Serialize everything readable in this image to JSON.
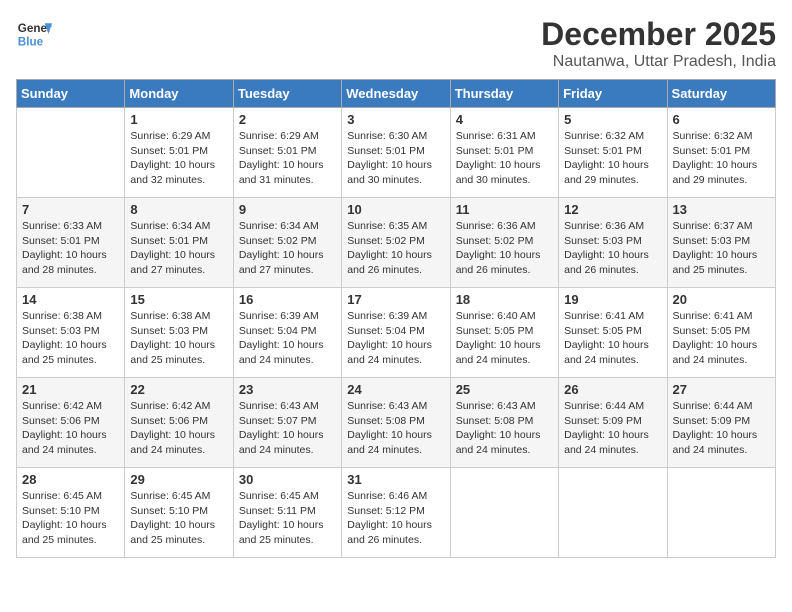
{
  "logo": {
    "line1": "General",
    "line2": "Blue"
  },
  "title": "December 2025",
  "subtitle": "Nautanwa, Uttar Pradesh, India",
  "headers": [
    "Sunday",
    "Monday",
    "Tuesday",
    "Wednesday",
    "Thursday",
    "Friday",
    "Saturday"
  ],
  "weeks": [
    [
      {
        "day": "",
        "sunrise": "",
        "sunset": "",
        "daylight": ""
      },
      {
        "day": "1",
        "sunrise": "Sunrise: 6:29 AM",
        "sunset": "Sunset: 5:01 PM",
        "daylight": "Daylight: 10 hours and 32 minutes."
      },
      {
        "day": "2",
        "sunrise": "Sunrise: 6:29 AM",
        "sunset": "Sunset: 5:01 PM",
        "daylight": "Daylight: 10 hours and 31 minutes."
      },
      {
        "day": "3",
        "sunrise": "Sunrise: 6:30 AM",
        "sunset": "Sunset: 5:01 PM",
        "daylight": "Daylight: 10 hours and 30 minutes."
      },
      {
        "day": "4",
        "sunrise": "Sunrise: 6:31 AM",
        "sunset": "Sunset: 5:01 PM",
        "daylight": "Daylight: 10 hours and 30 minutes."
      },
      {
        "day": "5",
        "sunrise": "Sunrise: 6:32 AM",
        "sunset": "Sunset: 5:01 PM",
        "daylight": "Daylight: 10 hours and 29 minutes."
      },
      {
        "day": "6",
        "sunrise": "Sunrise: 6:32 AM",
        "sunset": "Sunset: 5:01 PM",
        "daylight": "Daylight: 10 hours and 29 minutes."
      }
    ],
    [
      {
        "day": "7",
        "sunrise": "Sunrise: 6:33 AM",
        "sunset": "Sunset: 5:01 PM",
        "daylight": "Daylight: 10 hours and 28 minutes."
      },
      {
        "day": "8",
        "sunrise": "Sunrise: 6:34 AM",
        "sunset": "Sunset: 5:01 PM",
        "daylight": "Daylight: 10 hours and 27 minutes."
      },
      {
        "day": "9",
        "sunrise": "Sunrise: 6:34 AM",
        "sunset": "Sunset: 5:02 PM",
        "daylight": "Daylight: 10 hours and 27 minutes."
      },
      {
        "day": "10",
        "sunrise": "Sunrise: 6:35 AM",
        "sunset": "Sunset: 5:02 PM",
        "daylight": "Daylight: 10 hours and 26 minutes."
      },
      {
        "day": "11",
        "sunrise": "Sunrise: 6:36 AM",
        "sunset": "Sunset: 5:02 PM",
        "daylight": "Daylight: 10 hours and 26 minutes."
      },
      {
        "day": "12",
        "sunrise": "Sunrise: 6:36 AM",
        "sunset": "Sunset: 5:03 PM",
        "daylight": "Daylight: 10 hours and 26 minutes."
      },
      {
        "day": "13",
        "sunrise": "Sunrise: 6:37 AM",
        "sunset": "Sunset: 5:03 PM",
        "daylight": "Daylight: 10 hours and 25 minutes."
      }
    ],
    [
      {
        "day": "14",
        "sunrise": "Sunrise: 6:38 AM",
        "sunset": "Sunset: 5:03 PM",
        "daylight": "Daylight: 10 hours and 25 minutes."
      },
      {
        "day": "15",
        "sunrise": "Sunrise: 6:38 AM",
        "sunset": "Sunset: 5:03 PM",
        "daylight": "Daylight: 10 hours and 25 minutes."
      },
      {
        "day": "16",
        "sunrise": "Sunrise: 6:39 AM",
        "sunset": "Sunset: 5:04 PM",
        "daylight": "Daylight: 10 hours and 24 minutes."
      },
      {
        "day": "17",
        "sunrise": "Sunrise: 6:39 AM",
        "sunset": "Sunset: 5:04 PM",
        "daylight": "Daylight: 10 hours and 24 minutes."
      },
      {
        "day": "18",
        "sunrise": "Sunrise: 6:40 AM",
        "sunset": "Sunset: 5:05 PM",
        "daylight": "Daylight: 10 hours and 24 minutes."
      },
      {
        "day": "19",
        "sunrise": "Sunrise: 6:41 AM",
        "sunset": "Sunset: 5:05 PM",
        "daylight": "Daylight: 10 hours and 24 minutes."
      },
      {
        "day": "20",
        "sunrise": "Sunrise: 6:41 AM",
        "sunset": "Sunset: 5:05 PM",
        "daylight": "Daylight: 10 hours and 24 minutes."
      }
    ],
    [
      {
        "day": "21",
        "sunrise": "Sunrise: 6:42 AM",
        "sunset": "Sunset: 5:06 PM",
        "daylight": "Daylight: 10 hours and 24 minutes."
      },
      {
        "day": "22",
        "sunrise": "Sunrise: 6:42 AM",
        "sunset": "Sunset: 5:06 PM",
        "daylight": "Daylight: 10 hours and 24 minutes."
      },
      {
        "day": "23",
        "sunrise": "Sunrise: 6:43 AM",
        "sunset": "Sunset: 5:07 PM",
        "daylight": "Daylight: 10 hours and 24 minutes."
      },
      {
        "day": "24",
        "sunrise": "Sunrise: 6:43 AM",
        "sunset": "Sunset: 5:08 PM",
        "daylight": "Daylight: 10 hours and 24 minutes."
      },
      {
        "day": "25",
        "sunrise": "Sunrise: 6:43 AM",
        "sunset": "Sunset: 5:08 PM",
        "daylight": "Daylight: 10 hours and 24 minutes."
      },
      {
        "day": "26",
        "sunrise": "Sunrise: 6:44 AM",
        "sunset": "Sunset: 5:09 PM",
        "daylight": "Daylight: 10 hours and 24 minutes."
      },
      {
        "day": "27",
        "sunrise": "Sunrise: 6:44 AM",
        "sunset": "Sunset: 5:09 PM",
        "daylight": "Daylight: 10 hours and 24 minutes."
      }
    ],
    [
      {
        "day": "28",
        "sunrise": "Sunrise: 6:45 AM",
        "sunset": "Sunset: 5:10 PM",
        "daylight": "Daylight: 10 hours and 25 minutes."
      },
      {
        "day": "29",
        "sunrise": "Sunrise: 6:45 AM",
        "sunset": "Sunset: 5:10 PM",
        "daylight": "Daylight: 10 hours and 25 minutes."
      },
      {
        "day": "30",
        "sunrise": "Sunrise: 6:45 AM",
        "sunset": "Sunset: 5:11 PM",
        "daylight": "Daylight: 10 hours and 25 minutes."
      },
      {
        "day": "31",
        "sunrise": "Sunrise: 6:46 AM",
        "sunset": "Sunset: 5:12 PM",
        "daylight": "Daylight: 10 hours and 26 minutes."
      },
      {
        "day": "",
        "sunrise": "",
        "sunset": "",
        "daylight": ""
      },
      {
        "day": "",
        "sunrise": "",
        "sunset": "",
        "daylight": ""
      },
      {
        "day": "",
        "sunrise": "",
        "sunset": "",
        "daylight": ""
      }
    ]
  ]
}
